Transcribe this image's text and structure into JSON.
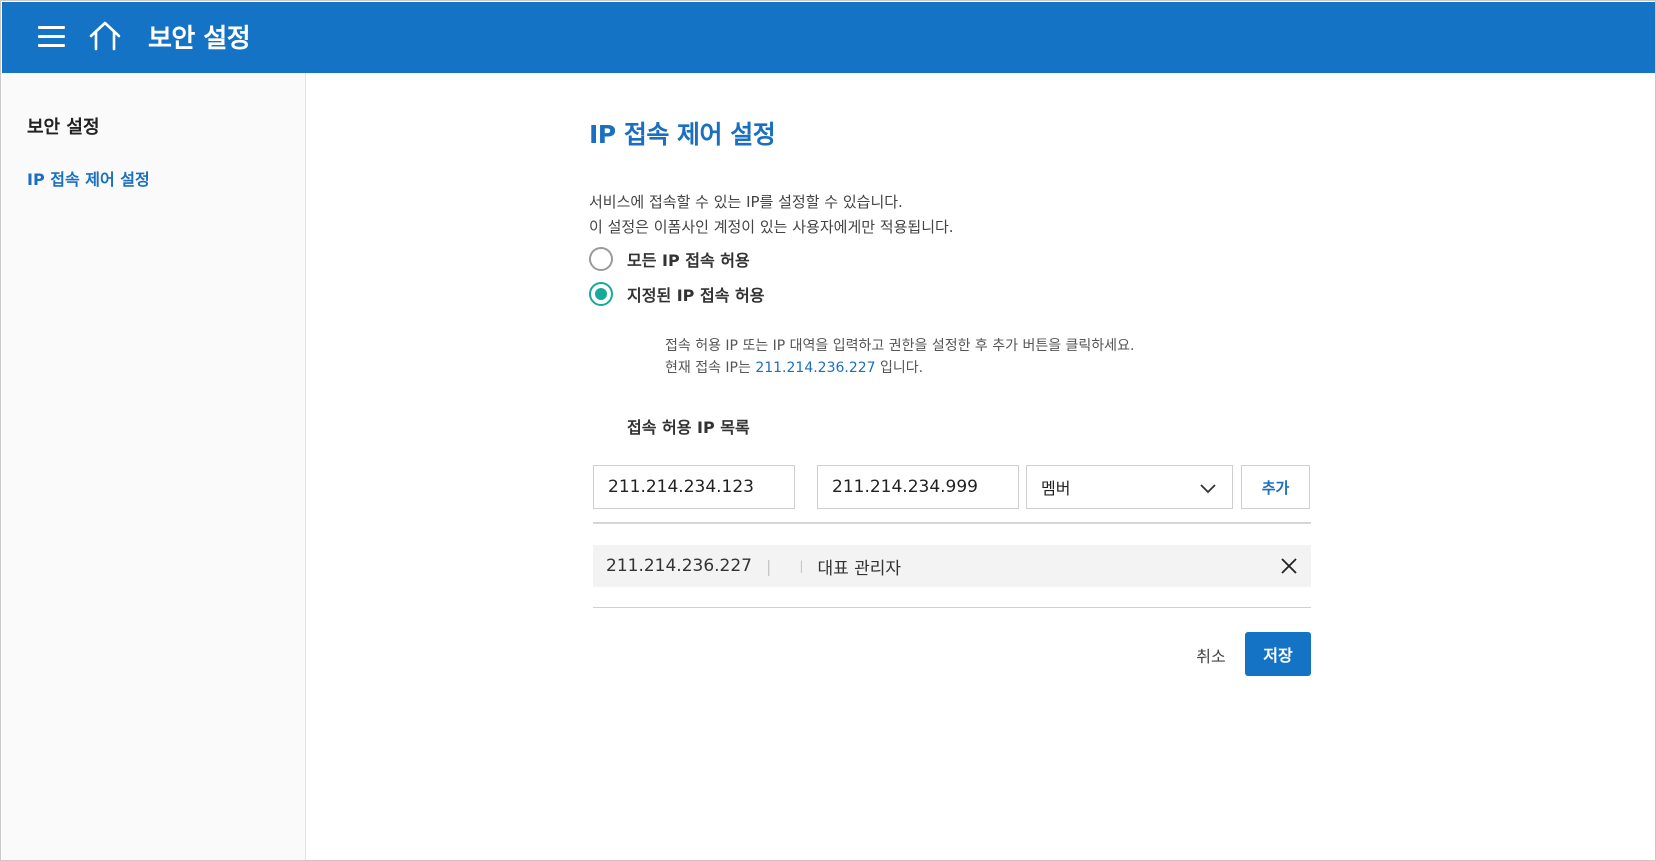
{
  "header": {
    "menu_icon": "hamburger-menu-icon",
    "home_icon": "home-icon",
    "title": "보안 설정",
    "bg_color": "#1473c5"
  },
  "sidebar": {
    "heading": "보안 설정",
    "items": [
      {
        "label": "IP 접속 제어 설정",
        "active": true
      }
    ]
  },
  "main": {
    "title": "IP 접속 제어 설정",
    "description": [
      "서비스에 접속할 수 있는 IP를 설정할 수 있습니다.",
      "이 설정은 이폼사인 계정이 있는 사용자에게만 적용됩니다."
    ],
    "options": [
      {
        "label": "모든 IP 접속 허용",
        "checked": false
      },
      {
        "label": "지정된 IP 접속 허용",
        "checked": true
      }
    ],
    "hint": {
      "line1": "접속 허용 IP 또는 IP 대역을 입력하고 권한을 설정한 후 추가 버튼을 클릭하세요.",
      "line2_prefix": "현재 접속 IP는 ",
      "current_ip": "211.214.236.227",
      "line2_suffix": " 입니다."
    },
    "list_title": "접속 허용 IP 목록",
    "form": {
      "ip_start": "211.214.234.123",
      "range_separator": "~",
      "ip_end": "211.214.234.999",
      "role_selected": "멤버",
      "add_label": "추가"
    },
    "entries": [
      {
        "ip": "211.214.236.227",
        "separator": "|",
        "role": "대표 관리자"
      }
    ],
    "actions": {
      "cancel_label": "취소",
      "save_label": "저장"
    }
  },
  "colors": {
    "accent": "#1a6fc0",
    "radio_checked": "#17a99a"
  }
}
